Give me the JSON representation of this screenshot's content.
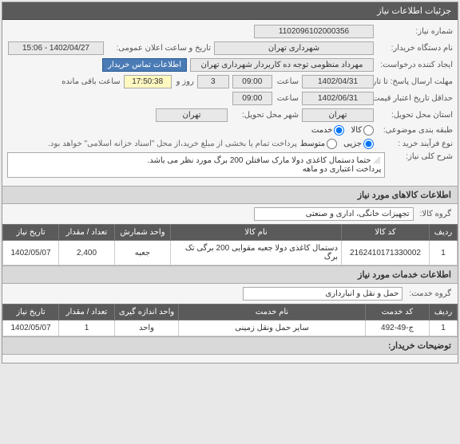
{
  "panel_title": "جزئیات اطلاعات نیاز",
  "form": {
    "need_no_label": "شماره نیاز:",
    "need_no": "1102096102000356",
    "buyer_label": "نام دستگاه خریدار:",
    "buyer": "شهرداری تهران",
    "requester_label": "ایجاد کننده درخواست:",
    "requester": "مهرداد منظومی توجه ده کاربردار شهرداری تهران",
    "contact_btn": "اطلاعات تماس خریدار",
    "deadline_label": "مهلت ارسال پاسخ: تا تاریخ:",
    "deadline_date": "1402/04/31",
    "time_label": "ساعت",
    "deadline_time": "09:00",
    "and_label": "روز و",
    "days": "3",
    "remain_time": "17:50:38",
    "remain_label": "ساعت باقی مانده",
    "valid_label": "حداقل تاریخ اعتبار قیمت: تا تاریخ:",
    "valid_date": "1402/06/31",
    "valid_time": "09:00",
    "delivery_loc_label": "استان محل تحویل:",
    "delivery_province": "تهران",
    "delivery_city_label": "شهر محل تحویل:",
    "delivery_city": "تهران",
    "category_label": "طبقه بندی موضوعی:",
    "cat_goods": "کالا",
    "cat_service": "خدمت",
    "buy_type_label": "نوع فرآیند خرید :",
    "bt_partial": "جزیی",
    "bt_medium": "متوسط",
    "buy_note": "پرداخت تمام یا بخشی از مبلغ خرید،از محل \"اسناد خزانه اسلامی\" خواهد بود.",
    "announce_label": "تاریخ و ساعت اعلان عمومی:",
    "announce_value": "1402/04/27 - 15:06"
  },
  "desc": {
    "label": "شرح کلی نیاز:",
    "line1": "حتما دستمال کاغذی دولا مارک سافتلن 200 برگ مورد نظر می باشد.",
    "line2": "پرداخت اعتباری دو ماهه"
  },
  "goods_section": "اطلاعات کالاهای مورد نیاز",
  "goods_group_label": "گروه کالا:",
  "goods_group": "تجهیزات خانگی، اداری و صنعتی",
  "goods_table": {
    "headers": [
      "ردیف",
      "کد کالا",
      "نام کالا",
      "واحد شمارش",
      "تعداد / مقدار",
      "تاریخ نیاز"
    ],
    "row": [
      "1",
      "2162410171330002",
      "دستمال کاغذی دولا جعبه مقوایی 200 برگی تک برگ",
      "جعبه",
      "2,400",
      "1402/05/07"
    ]
  },
  "services_section": "اطلاعات خدمات مورد نیاز",
  "services_group_label": "گروه خدمت:",
  "services_group": "حمل و نقل و انبارداری",
  "services_table": {
    "headers": [
      "ردیف",
      "کد خدمت",
      "نام خدمت",
      "واحد اندازه گیری",
      "تعداد / مقدار",
      "تاریخ نیاز"
    ],
    "row": [
      "1",
      "ج-49-492",
      "سایر حمل ونقل زمینی",
      "واحد",
      "1",
      "1402/05/07"
    ]
  },
  "buyer_notes_section": "توضیحات خریدار:"
}
